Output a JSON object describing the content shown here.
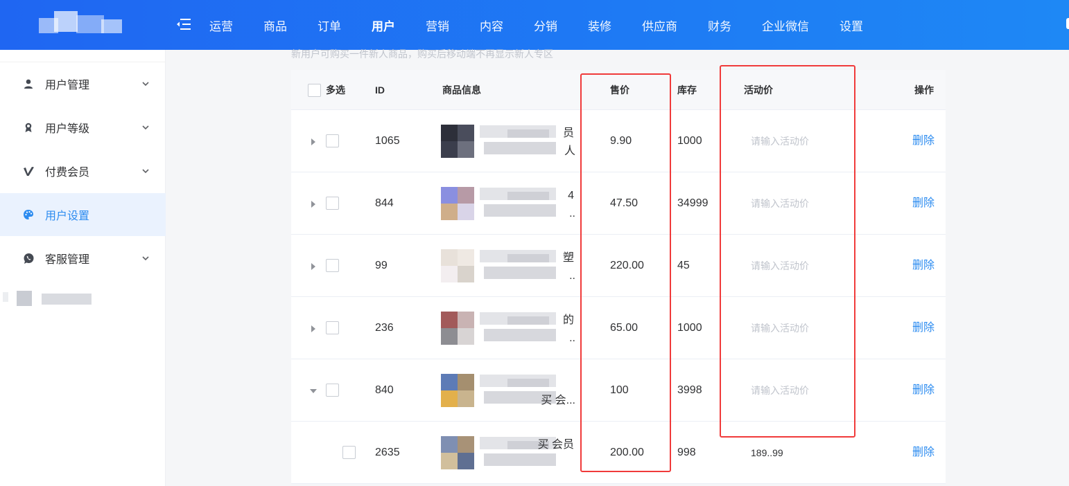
{
  "nav": {
    "items": [
      {
        "label": "运营",
        "active": false
      },
      {
        "label": "商品",
        "active": false
      },
      {
        "label": "订单",
        "active": false
      },
      {
        "label": "用户",
        "active": true
      },
      {
        "label": "营销",
        "active": false
      },
      {
        "label": "内容",
        "active": false
      },
      {
        "label": "分销",
        "active": false
      },
      {
        "label": "装修",
        "active": false
      },
      {
        "label": "供应商",
        "active": false
      },
      {
        "label": "财务",
        "active": false
      },
      {
        "label": "企业微信",
        "active": false
      },
      {
        "label": "设置",
        "active": false
      }
    ]
  },
  "sidebar": {
    "items": [
      {
        "label": "用户管理",
        "icon": "user-icon",
        "expandable": true,
        "active": false
      },
      {
        "label": "用户等级",
        "icon": "award-icon",
        "expandable": true,
        "active": false
      },
      {
        "label": "付费会员",
        "icon": "vimeo-v-icon",
        "expandable": true,
        "active": false
      },
      {
        "label": "用户设置",
        "icon": "palette-icon",
        "expandable": false,
        "active": true
      },
      {
        "label": "客服管理",
        "icon": "whatsapp-icon",
        "expandable": true,
        "active": false
      }
    ]
  },
  "main": {
    "hint": "新用户可购买一件新人商品，购买后移动端不再显示新人专区",
    "table": {
      "columns": {
        "select": "多选",
        "id": "ID",
        "info": "商品信息",
        "price": "售价",
        "stock": "库存",
        "activity_price": "活动价",
        "actions": "操作"
      },
      "rows": [
        {
          "id": "1065",
          "name_line1": "员",
          "name_line2": "人",
          "price": "9.90",
          "stock": "1000",
          "activity_price": "请输入活动价",
          "activity_is_placeholder": true,
          "action": "删除",
          "expand": "collapsed",
          "child": false
        },
        {
          "id": "844",
          "name_line1": "4",
          "name_line2": "..",
          "price": "47.50",
          "stock": "34999",
          "activity_price": "请输入活动价",
          "activity_is_placeholder": true,
          "action": "删除",
          "expand": "collapsed",
          "child": false
        },
        {
          "id": "99",
          "name_line1": "塑",
          "name_line2": "..",
          "price": "220.00",
          "stock": "45",
          "activity_price": "请输入活动价",
          "activity_is_placeholder": true,
          "action": "删除",
          "expand": "collapsed",
          "child": false
        },
        {
          "id": "236",
          "name_line1": "的",
          "name_line2": "..",
          "price": "65.00",
          "stock": "1000",
          "activity_price": "请输入活动价",
          "activity_is_placeholder": true,
          "action": "删除",
          "expand": "collapsed",
          "child": false
        },
        {
          "id": "840",
          "name_line1": "",
          "name_line2": "买 会...",
          "price": "100",
          "stock": "3998",
          "activity_price": "请输入活动价",
          "activity_is_placeholder": true,
          "action": "删除",
          "expand": "expanded",
          "child": false
        },
        {
          "id": "2635",
          "name_line1": "买 会员",
          "name_line2": "",
          "price": "200.00",
          "stock": "998",
          "activity_price": "189..99",
          "activity_is_placeholder": false,
          "action": "删除",
          "expand": "none",
          "child": true
        }
      ]
    }
  },
  "colors": {
    "topbar_start": "#1f66f2",
    "topbar_end": "#1e88f5",
    "accent": "#2d8cf0",
    "highlight_box": "#f03a3a"
  }
}
